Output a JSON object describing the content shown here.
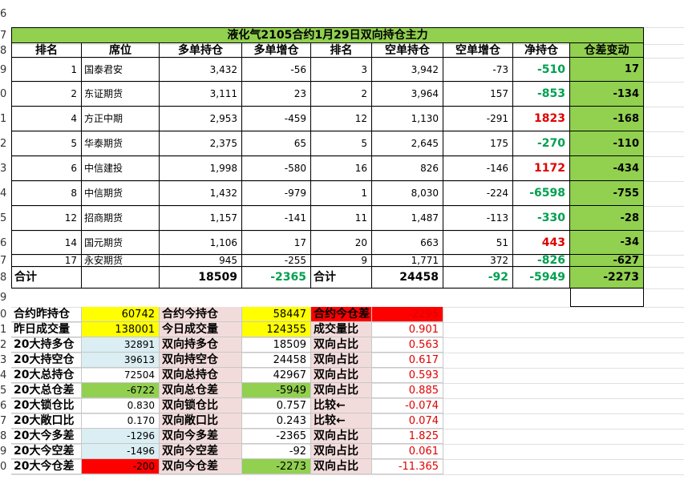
{
  "row_numbers": [
    "6",
    "7",
    "8",
    "9",
    "0",
    "1",
    "2",
    "3",
    "4",
    "5",
    "6",
    "7",
    "8",
    "9",
    "0",
    "1",
    "2",
    "3",
    "4",
    "5",
    "6",
    "7",
    "8",
    "9",
    "0"
  ],
  "title": "液化气2105合约1月29日双向持仓主力",
  "headers": [
    "排名",
    "席位",
    "多单持仓",
    "多单增仓",
    "排名",
    "空单持仓",
    "空单增仓",
    "净持仓",
    "仓差变动"
  ],
  "rows": [
    {
      "rank": "1",
      "seat": "国泰君安",
      "long": "3,432",
      "long_chg": "-56",
      "srank": "3",
      "short": "3,942",
      "short_chg": "-73",
      "net": "-510",
      "diff": "17"
    },
    {
      "rank": "2",
      "seat": "东证期货",
      "long": "3,111",
      "long_chg": "23",
      "srank": "2",
      "short": "3,964",
      "short_chg": "157",
      "net": "-853",
      "diff": "-134"
    },
    {
      "rank": "4",
      "seat": "方正中期",
      "long": "2,953",
      "long_chg": "-459",
      "srank": "12",
      "short": "1,130",
      "short_chg": "-291",
      "net": "1823",
      "diff": "-168"
    },
    {
      "rank": "5",
      "seat": "华泰期货",
      "long": "2,375",
      "long_chg": "65",
      "srank": "5",
      "short": "2,645",
      "short_chg": "175",
      "net": "-270",
      "diff": "-110"
    },
    {
      "rank": "6",
      "seat": "中信建投",
      "long": "1,998",
      "long_chg": "-580",
      "srank": "16",
      "short": "826",
      "short_chg": "-146",
      "net": "1172",
      "diff": "-434"
    },
    {
      "rank": "8",
      "seat": "中信期货",
      "long": "1,432",
      "long_chg": "-979",
      "srank": "1",
      "short": "8,030",
      "short_chg": "-224",
      "net": "-6598",
      "diff": "-755"
    },
    {
      "rank": "12",
      "seat": "招商期货",
      "long": "1,157",
      "long_chg": "-141",
      "srank": "11",
      "short": "1,487",
      "short_chg": "-113",
      "net": "-330",
      "diff": "-28"
    },
    {
      "rank": "14",
      "seat": "国元期货",
      "long": "1,106",
      "long_chg": "17",
      "srank": "20",
      "short": "663",
      "short_chg": "51",
      "net": "443",
      "diff": "-34"
    },
    {
      "rank": "17",
      "seat": "永安期货",
      "long": "945",
      "long_chg": "-255",
      "srank": "9",
      "short": "1,771",
      "short_chg": "372",
      "net": "-826",
      "diff": "-627"
    }
  ],
  "total": {
    "label": "合计",
    "long": "18509",
    "long_chg": "-2365",
    "label2": "合计",
    "short": "24458",
    "short_chg": "-92",
    "net": "-5949",
    "diff": "-2273"
  },
  "lower": [
    {
      "a": "合约昨持仓",
      "b": "60742",
      "c": "合约今持仓",
      "d": "58447",
      "e": "合约今仓差",
      "f": "-2295"
    },
    {
      "a": "昨日成交量",
      "b": "138001",
      "c": "今日成交量",
      "d": "124355",
      "e": "成交量比",
      "f": "0.901"
    },
    {
      "a": "20大持多仓",
      "b": "32891",
      "c": "双向持多仓",
      "d": "18509",
      "e": "双向占比",
      "f": "0.563"
    },
    {
      "a": "20大持空仓",
      "b": "39613",
      "c": "双向持空仓",
      "d": "24458",
      "e": "双向占比",
      "f": "0.617"
    },
    {
      "a": "20大总持仓",
      "b": "72504",
      "c": "双向总持仓",
      "d": "42967",
      "e": "双向占比",
      "f": "0.593"
    },
    {
      "a": "20大总仓差",
      "b": "-6722",
      "c": "双向总仓差",
      "d": "-5949",
      "e": "双向占比",
      "f": "0.885"
    },
    {
      "a": "20大锁仓比",
      "b": "0.830",
      "c": "双向锁仓比",
      "d": "0.757",
      "e": "比较←",
      "f": "-0.074"
    },
    {
      "a": "20大敞口比",
      "b": "0.170",
      "c": "双向敞口比",
      "d": "0.243",
      "e": "比较←",
      "f": "0.074"
    },
    {
      "a": "20大今多差",
      "b": "-1296",
      "c": "双向今多差",
      "d": "-2365",
      "e": "双向占比",
      "f": "1.825"
    },
    {
      "a": "20大今空差",
      "b": "-1496",
      "c": "双向今空差",
      "d": "-92",
      "e": "双向占比",
      "f": "0.061"
    },
    {
      "a": "20大今仓差",
      "b": "-200",
      "c": "双向今仓差",
      "d": "-2273",
      "e": "双向占比",
      "f": "-11.365"
    }
  ],
  "colors": {
    "green_band": "#92d050",
    "yellow": "#ffff00",
    "pink": "#f2dcdb",
    "blue": "#daeef3",
    "red": "#ff0000",
    "net_green": "#00a050",
    "net_red": "#e00000"
  }
}
